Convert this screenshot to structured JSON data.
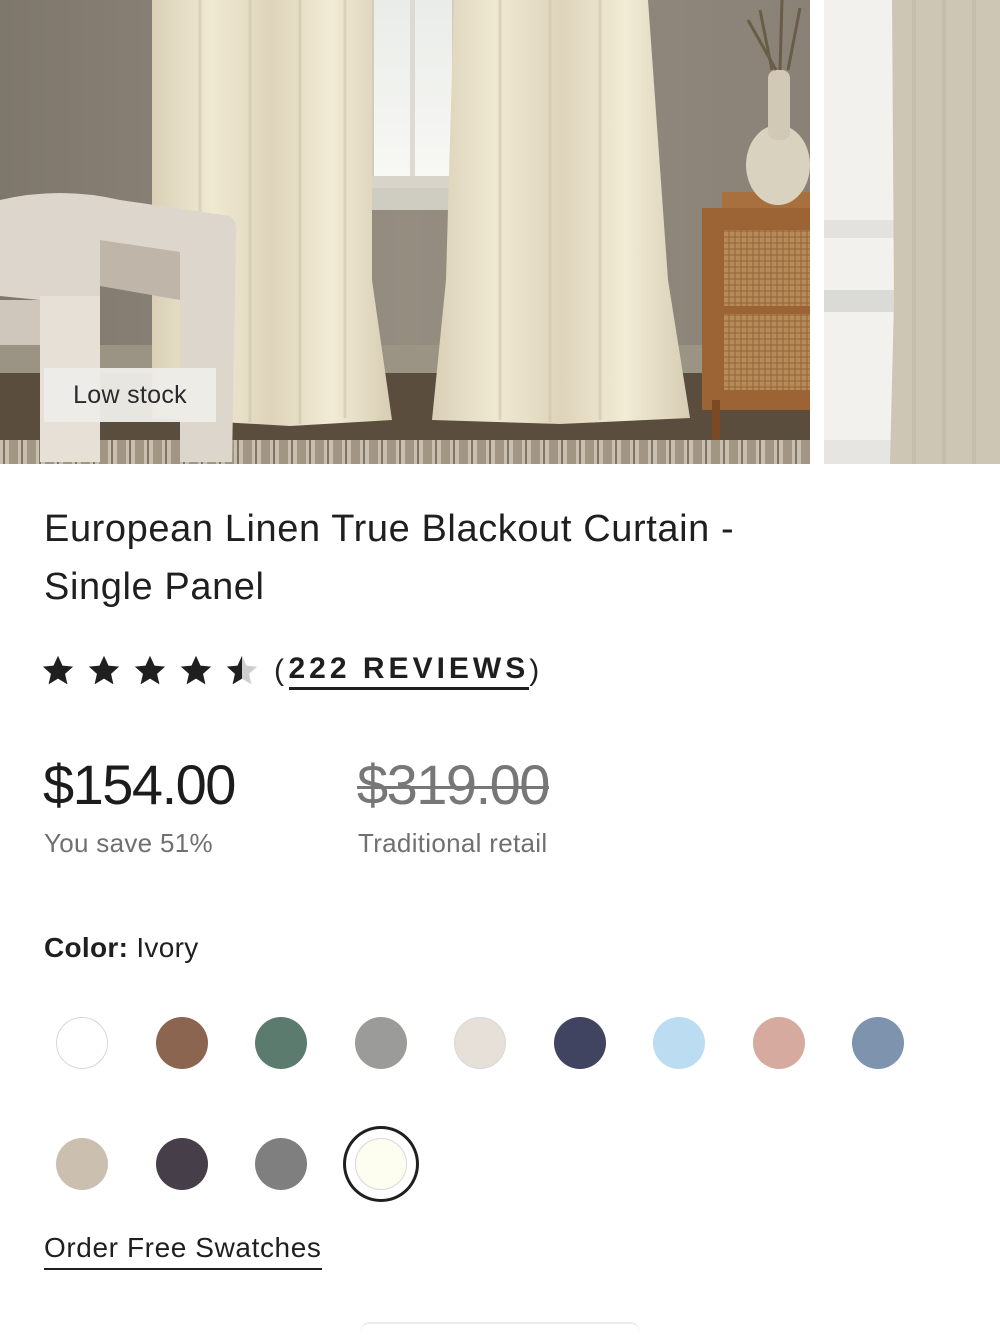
{
  "gallery": {
    "badge": "Low stock",
    "images": [
      {
        "icon": "living-room-curtain-photo"
      },
      {
        "icon": "curtain-closeup-photo"
      }
    ]
  },
  "product": {
    "title_line1": "European Linen True Blackout Curtain -",
    "title_line2": "Single Panel",
    "rating": 4.5,
    "rating_max": 5,
    "reviews_open": "(",
    "reviews_label": "222 REVIEWS",
    "reviews_close": ")",
    "price": "$154.00",
    "savings": "You save 51%",
    "original_price": "$319.00",
    "original_label": "Traditional retail"
  },
  "color": {
    "label": "Color:",
    "selected": "Ivory",
    "swatches": [
      {
        "hex": "#ffffff"
      },
      {
        "hex": "#8c6550"
      },
      {
        "hex": "#5b7b6e"
      },
      {
        "hex": "#9b9b99"
      },
      {
        "hex": "#e6e0d9"
      },
      {
        "hex": "#404461"
      },
      {
        "hex": "#bcdcf1"
      },
      {
        "hex": "#d7aaa0"
      },
      {
        "hex": "#7d93ae"
      },
      {
        "hex": "#cbbfb0"
      },
      {
        "hex": "#463f4a"
      },
      {
        "hex": "#7f7f7f"
      },
      {
        "hex": "#fdfdf0",
        "selected": true
      }
    ]
  },
  "actions": {
    "order_swatches": "Order Free Swatches"
  }
}
